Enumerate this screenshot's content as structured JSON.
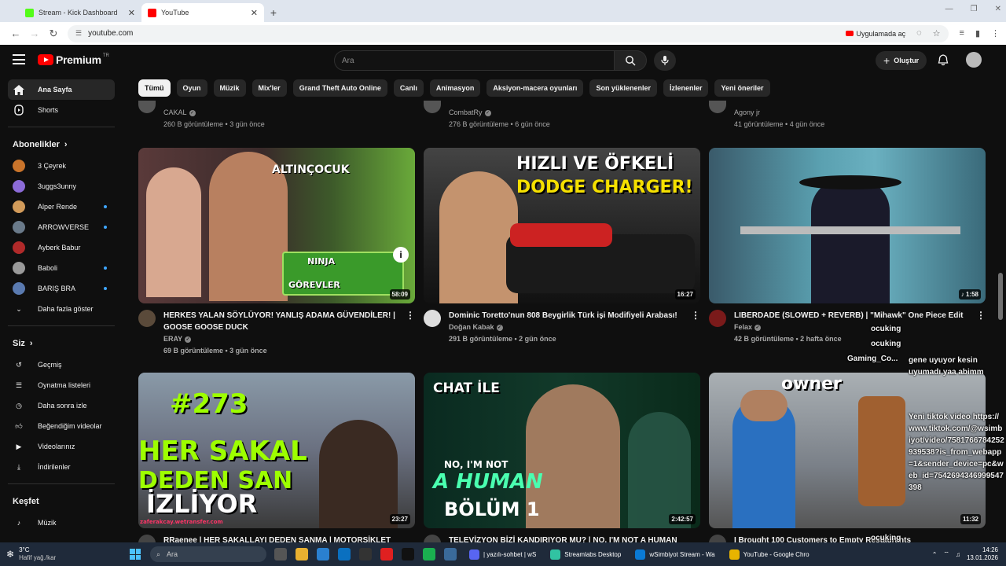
{
  "browser": {
    "tabs": [
      {
        "title": "Stream - Kick Dashboard",
        "fav_color": "#53fc18",
        "active": false
      },
      {
        "title": "YouTube",
        "fav_color": "#ff0000",
        "active": true
      }
    ],
    "url": "youtube.com",
    "open_in_app_label": "Uygulamada aç"
  },
  "header": {
    "logo_text": "Premium",
    "logo_region": "TR",
    "search_placeholder": "Ara",
    "create_label": "Oluştur"
  },
  "sidebar": {
    "main": [
      {
        "label": "Ana Sayfa",
        "icon": "home-icon",
        "active": true
      },
      {
        "label": "Shorts",
        "icon": "shorts-icon",
        "active": false
      }
    ],
    "subscriptions_title": "Abonelikler",
    "subscriptions": [
      {
        "label": "3 Çeyrek",
        "color": "#c9742b",
        "dot": false
      },
      {
        "label": "3uggs3unny",
        "color": "#8c6bd8",
        "dot": false
      },
      {
        "label": "Alper Rende",
        "color": "#d29b5a",
        "dot": true
      },
      {
        "label": "ARROWVERSE",
        "color": "#6a7a8a",
        "dot": true
      },
      {
        "label": "Ayberk Babur",
        "color": "#b02a2a",
        "dot": false
      },
      {
        "label": "Baboli",
        "color": "#9a9a9a",
        "dot": true
      },
      {
        "label": "BARIŞ BRA",
        "color": "#5a7ab0",
        "dot": true
      }
    ],
    "show_more_label": "Daha fazla göster",
    "you_title": "Siz",
    "you_items": [
      {
        "label": "Geçmiş",
        "icon": "history-icon"
      },
      {
        "label": "Oynatma listeleri",
        "icon": "playlists-icon"
      },
      {
        "label": "Daha sonra izle",
        "icon": "watch-later-icon"
      },
      {
        "label": "Beğendiğim videolar",
        "icon": "liked-icon"
      },
      {
        "label": "Videolarınız",
        "icon": "your-videos-icon"
      },
      {
        "label": "İndirilenler",
        "icon": "download-icon"
      }
    ],
    "explore_title": "Keşfet",
    "explore_items": [
      {
        "label": "Müzik",
        "icon": "music-icon"
      }
    ]
  },
  "chips": [
    "Tümü",
    "Oyun",
    "Müzik",
    "Mix'ler",
    "Grand Theft Auto Online",
    "Canlı",
    "Animasyon",
    "Aksiyon-macera oyunları",
    "Son yüklenenler",
    "İzlenenler",
    "Yeni öneriler"
  ],
  "prev_row": [
    {
      "channel": "CAKAL",
      "stats": "260 B görüntüleme • 3 gün önce",
      "verified": true
    },
    {
      "channel": "CombatRy",
      "stats": "276 B görüntüleme • 6 gün önce",
      "verified": true
    },
    {
      "channel": "Agony jr",
      "stats": "41 görüntüleme • 4 gün önce",
      "verified": false
    }
  ],
  "videos": [
    {
      "title": "HERKES YALAN SÖYLÜYOR! YANLIŞ ADAMA GÜVENDİLER! | GOOSE GOOSE DUCK",
      "channel": "ERAY",
      "stats": "69 B görüntüleme • 3 gün önce",
      "duration": "58:09",
      "verified": true,
      "thumb_text": [
        "ALTINÇOCUK",
        "NINJA",
        "GÖREVLER"
      ],
      "avatar_color": "#5a4a3a"
    },
    {
      "title": "Dominic Toretto'nun 808 Beygirlik Türk işi Modifiyeli Arabası!",
      "channel": "Doğan Kabak",
      "stats": "291 B görüntüleme • 2 gün önce",
      "duration": "16:27",
      "verified": true,
      "thumb_text": [
        "HIZLI VE ÖFKELİ",
        "DODGE CHARGER!"
      ],
      "avatar_color": "#ddd"
    },
    {
      "title": "LIBERDADE (SLOWED + REVERB) | \"Mihawk\" One Piece Edit",
      "channel": "Felax",
      "stats": "42 B görüntüleme • 2 hafta önce",
      "duration": "1:58",
      "verified": true,
      "thumb_text": [],
      "avatar_color": "#7a1a1a"
    },
    {
      "title": "RRaenee | HER SAKALLAYI DEDEN SANMA | MOTORSİKLET",
      "channel": "",
      "stats": "",
      "duration": "23:27",
      "verified": false,
      "thumb_text": [
        "#273",
        "HER SAKAL",
        "DEDEN SAN",
        "İZLİYOR",
        "zaferakcay.wetransfer.com"
      ],
      "avatar_color": "#444"
    },
    {
      "title": "TELEVİZYON BİZİ KANDIRIYOR MU? | NO, I'M NOT A HUMAN |",
      "channel": "",
      "stats": "",
      "duration": "2:42:57",
      "verified": false,
      "thumb_text": [
        "CHAT İLE",
        "NO, I'M NOT",
        "A HUMAN",
        "BÖLÜM 1"
      ],
      "avatar_color": "#444"
    },
    {
      "title": "I Brought 100 Customers to Empty Restaurants",
      "channel": "",
      "stats": "",
      "duration": "11:32",
      "verified": false,
      "thumb_text": [
        "owner"
      ],
      "avatar_color": "#444"
    }
  ],
  "chat_overlay": [
    {
      "text": "ocuking",
      "color": "#f0c050"
    },
    {
      "text": "ocuking",
      "color": "#f0c050"
    },
    {
      "text": "Gaming_Co...",
      "color": "#e0304a"
    },
    {
      "text": "gene uyuyor kesin uyumadı yaa abimm",
      "color": "#ffffff"
    },
    {
      "text": "Yeni tiktok video https://www.tiktok.com/@wsimbiyot/video/7581766784252939538?is_from_webapp=1&sender_device=pc&web_id=7542694346999547398",
      "color": "#ffffff"
    },
    {
      "text": "ocuking",
      "color": "#f0c050"
    },
    {
      "text": "ocuking",
      "color": "#f0c050"
    }
  ],
  "taskbar": {
    "temp": "3°C",
    "weather": "Hafif yağ./kar",
    "search_placeholder": "Ara",
    "tasks": [
      {
        "label": "| yazılı-sohbet | wS",
        "color": "#5865f2"
      },
      {
        "label": "Streamlabs Desktop",
        "color": "#31c3a2"
      },
      {
        "label": "wSimbiyot Stream - Wa",
        "color": "#0a7ad4"
      },
      {
        "label": "YouTube - Google Chro",
        "color": "#e8b400"
      }
    ],
    "time": "14:26",
    "date": "13.01.2026"
  }
}
